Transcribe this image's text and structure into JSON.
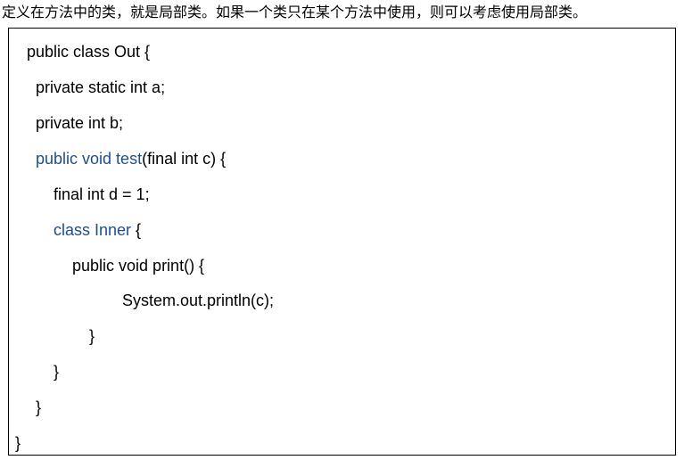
{
  "intro_text": "定义在方法中的类，就是局部类。如果一个类只在某个方法中使用，则可以考虑使用局部类。",
  "code": {
    "line1": "public class Out {",
    "line2": "private static int a;",
    "line3": "private int b;",
    "line4_blue": "public void test",
    "line4_rest": "(final int c) {",
    "line5": "final int d = 1;",
    "line6_blue": "class Inner",
    "line6_rest": " {",
    "line7": "public void print() {",
    "line8": "System.out.println(c);",
    "line9": "}",
    "line10": "}",
    "line11": "}",
    "line12": "}"
  },
  "colors": {
    "keyword_blue": "#1f4e8c",
    "text": "#000000",
    "border": "#000000"
  }
}
